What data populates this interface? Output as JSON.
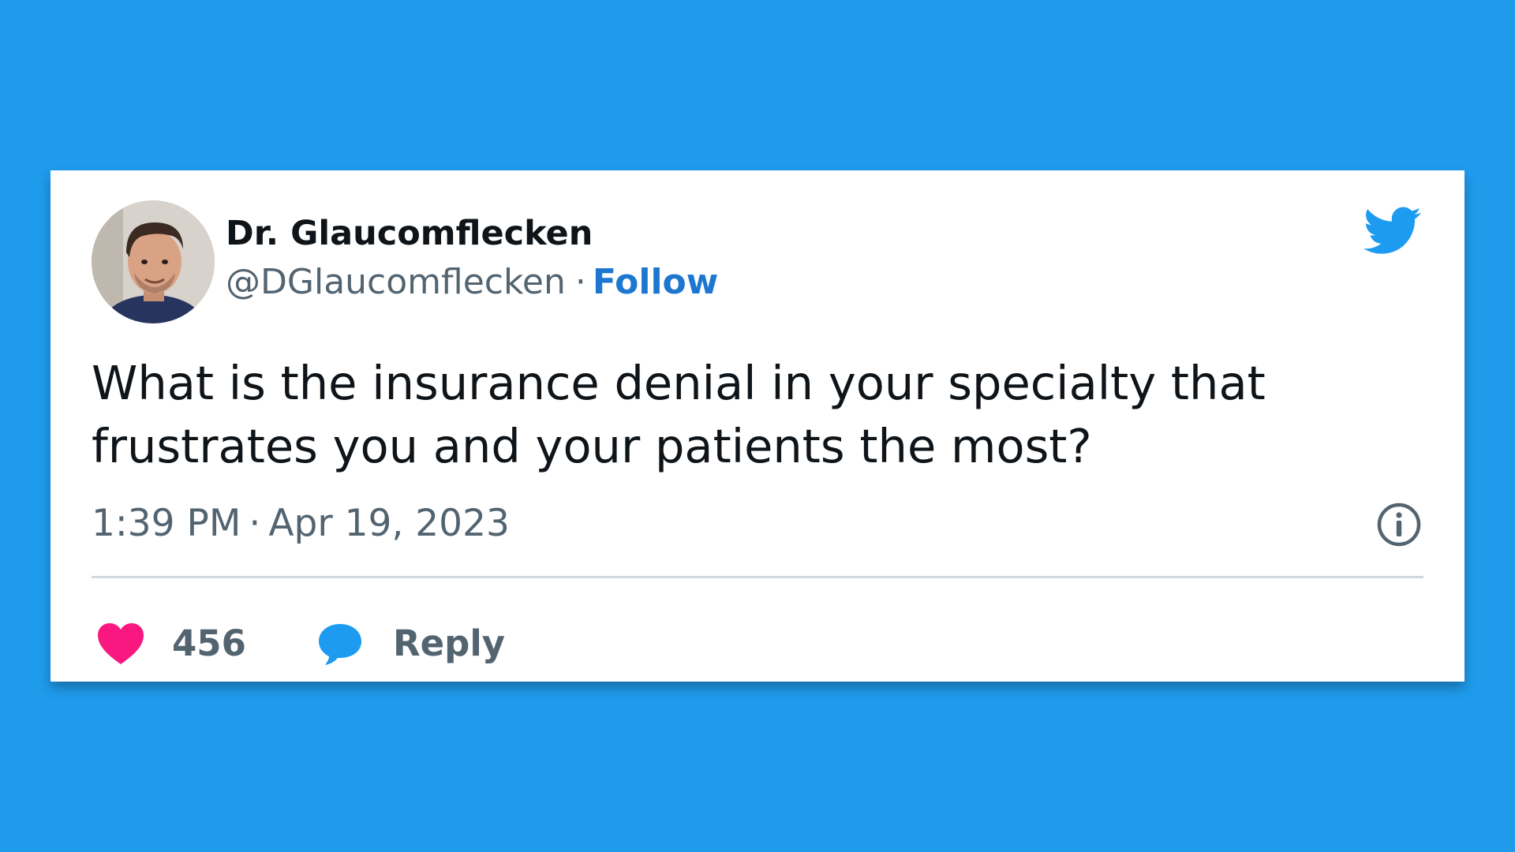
{
  "tweet": {
    "author": {
      "display_name": "Dr. Glaucomflecken",
      "handle": "@DGlaucomflecken",
      "separator": "·",
      "follow_label": "Follow",
      "avatar": "profile-photo"
    },
    "text": "What is the insurance denial in your specialty that frustrates you and your patients the most?",
    "time": "1:39 PM",
    "meta_separator": "·",
    "date": "Apr 19, 2023",
    "likes_count": "456",
    "reply_label": "Reply"
  },
  "icons": {
    "brand": "twitter-bird-icon",
    "info": "info-icon",
    "like": "heart-icon",
    "reply": "reply-bubble-icon"
  },
  "colors": {
    "background": "#1f9bec",
    "card": "#ffffff",
    "brand_blue": "#1d9bf0",
    "follow_link": "#1d77d0",
    "heart": "#f91880",
    "text_primary": "#0f1419",
    "text_secondary": "#536471",
    "divider": "#cfd9de"
  }
}
